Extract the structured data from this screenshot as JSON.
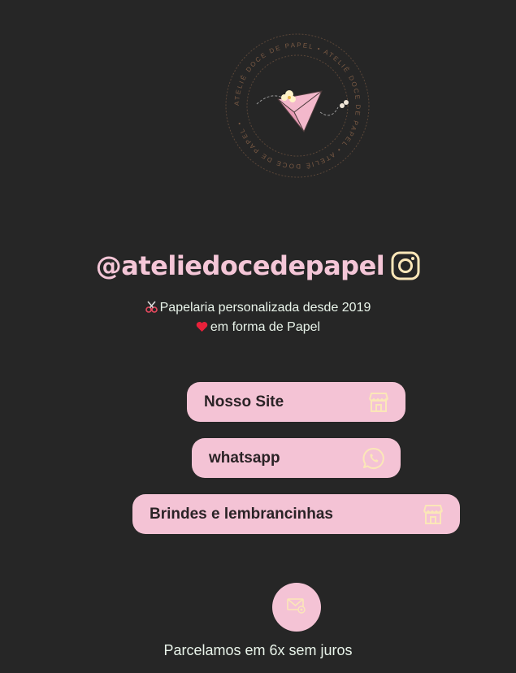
{
  "profile": {
    "handle": "@ateliedocedepapel",
    "bio_line1": "Papelaria personalizada desde 2019",
    "bio_line2": "em forma de Papel",
    "logo_ring_text": "ATELIÊ DOCE DE PAPEL • ATELIÊ DOCE DE PAPEL • ATELIÊ DOCE DE PAPEL •"
  },
  "links": [
    {
      "label": "Nosso Site",
      "icon": "store-icon"
    },
    {
      "label": "whatsapp",
      "icon": "whatsapp-icon"
    },
    {
      "label": "Brindes e lembrancinhas",
      "icon": "store-icon"
    }
  ],
  "footer": {
    "text": "Parcelamos em 6x sem juros"
  },
  "colors": {
    "background": "#262626",
    "pink": "#f4c3d5",
    "icon_cream": "#fbe7b8",
    "text_light": "#e9f4ea"
  }
}
